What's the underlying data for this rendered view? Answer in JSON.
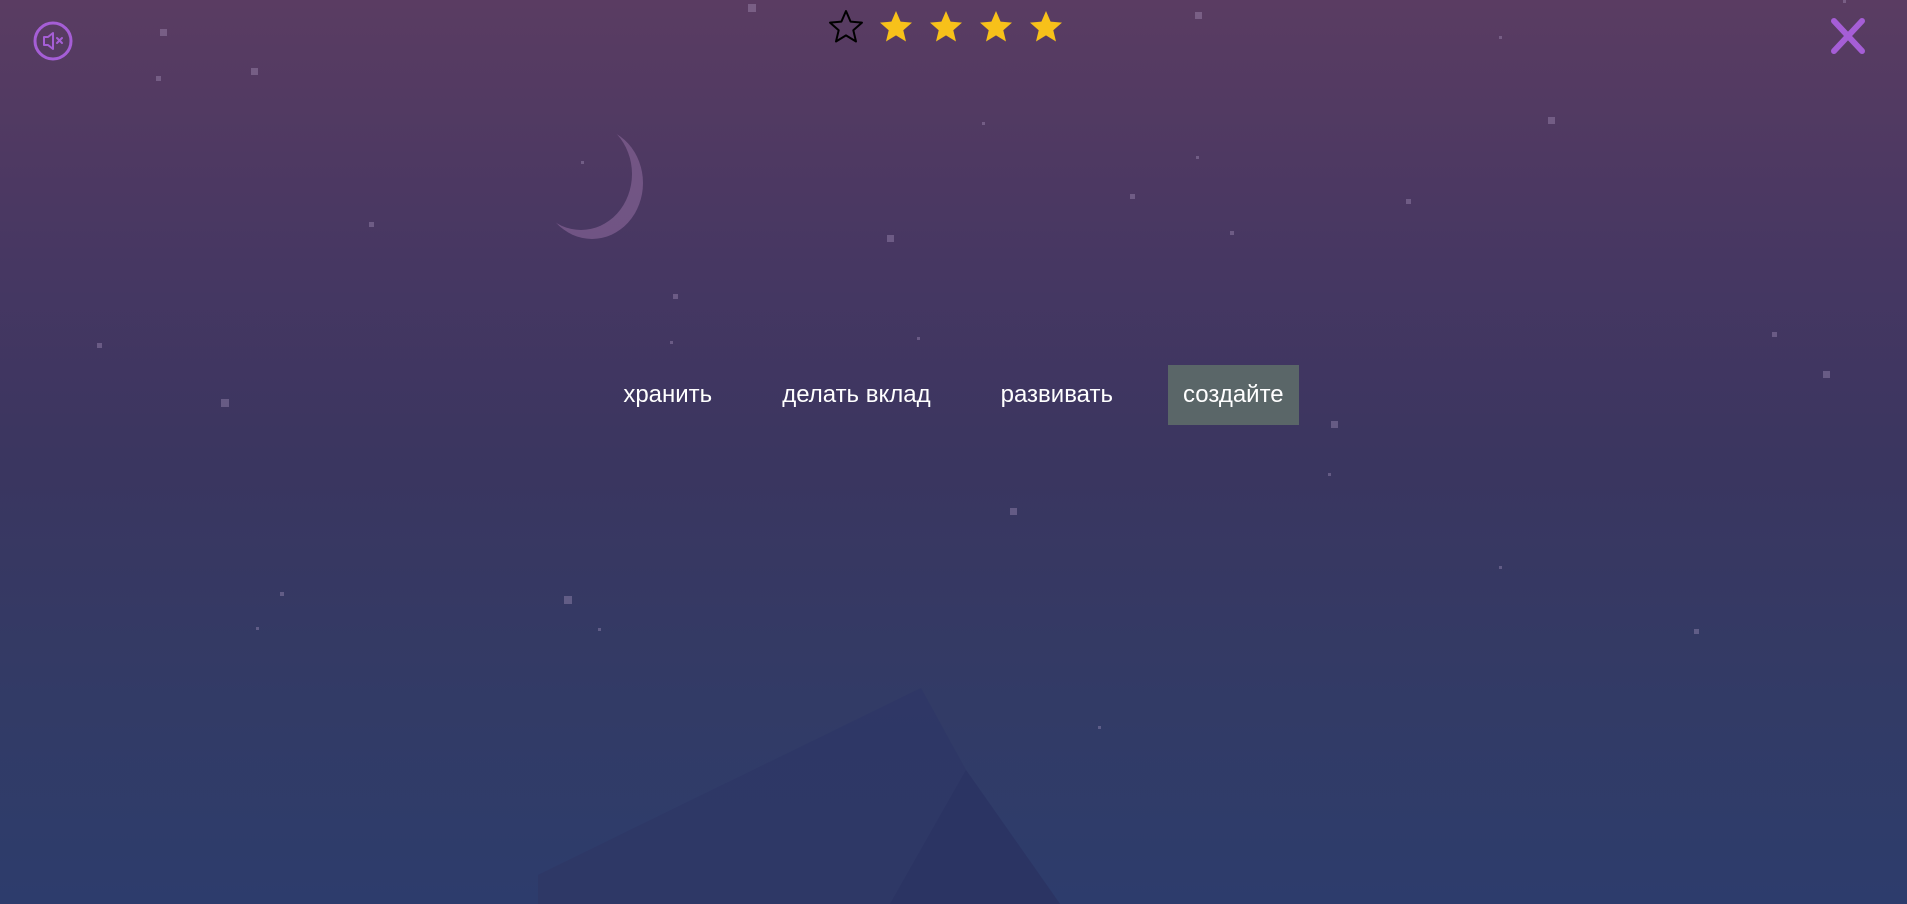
{
  "controls": {
    "mute_icon": "speaker-muted-icon",
    "close_icon": "close-x-icon",
    "accent_color": "#a55ed6"
  },
  "rating": {
    "filled": 4,
    "total": 5,
    "filled_color": "#f7c11a",
    "empty_color": "#000000"
  },
  "options": [
    {
      "label": "хранить",
      "selected": false
    },
    {
      "label": "делать вклад",
      "selected": false
    },
    {
      "label": "развивать",
      "selected": false
    },
    {
      "label": "создайте",
      "selected": true
    }
  ],
  "selected_color": "#5a6668"
}
